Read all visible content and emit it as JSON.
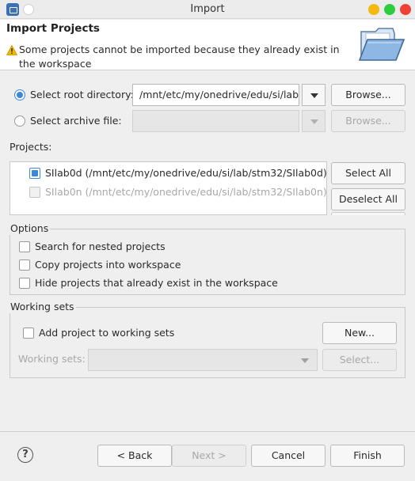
{
  "window": {
    "title": "Import"
  },
  "header": {
    "title": "Import Projects",
    "message": "Some projects cannot be imported because they already exist in the workspace"
  },
  "source": {
    "root_directory_label": "Select root directory:",
    "root_directory_value": "/mnt/etc/my/onedrive/edu/si/lab",
    "archive_label": "Select archive file:",
    "archive_value": "",
    "browse_label": "Browse...",
    "browse_disabled_label": "Browse...",
    "selected": "root_directory"
  },
  "projects": {
    "label": "Projects:",
    "items": [
      {
        "label": "SIlab0d (/mnt/etc/my/onedrive/edu/si/lab/stm32/SIlab0d)",
        "checked": true,
        "enabled": true
      },
      {
        "label": "SIlab0n (/mnt/etc/my/onedrive/edu/si/lab/stm32/SIlab0n)",
        "checked": false,
        "enabled": false
      }
    ],
    "select_all_label": "Select All",
    "deselect_all_label": "Deselect All"
  },
  "options": {
    "title": "Options",
    "search_nested": "Search for nested projects",
    "copy_into_workspace": "Copy projects into workspace",
    "hide_existing": "Hide projects that already exist in the workspace"
  },
  "working_sets": {
    "title": "Working sets",
    "add_to_working_sets": "Add project to working sets",
    "new_label": "New...",
    "field_label": "Working sets:",
    "select_label": "Select..."
  },
  "footer": {
    "help": "?",
    "back_label": "< Back",
    "next_label": "Next >",
    "cancel_label": "Cancel",
    "finish_label": "Finish"
  },
  "colors": {
    "accent": "#3b89d6",
    "warning": "#f2b705",
    "window_min": "#f5b90f",
    "window_max": "#2ecc40",
    "window_close": "#ef4136"
  }
}
